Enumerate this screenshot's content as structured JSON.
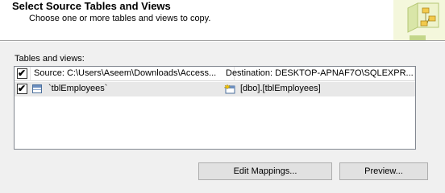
{
  "header": {
    "title": "Select Source Tables and Views",
    "subtitle": "Choose one or more tables and views to copy."
  },
  "grid": {
    "label": "Tables and views:",
    "columns": {
      "source": "Source: C:\\Users\\Aseem\\Downloads\\Access...",
      "destination": "Destination: DESKTOP-APNAF7O\\SQLEXPR..."
    },
    "rows": [
      {
        "checked": true,
        "source": "`tblEmployees`",
        "destination": "[dbo].[tblEmployees]"
      }
    ]
  },
  "buttons": {
    "edit_mappings": "Edit Mappings...",
    "preview": "Preview..."
  },
  "colors": {
    "header_bg": "#ffffff",
    "body_bg": "#f0f0f0",
    "row_selected_bg": "#e8e8e8"
  },
  "icons": {
    "wizard": "wizard-flowchart-icon",
    "source_table": "table-icon",
    "destination_table": "new-table-icon",
    "check": "checkmark-icon"
  }
}
